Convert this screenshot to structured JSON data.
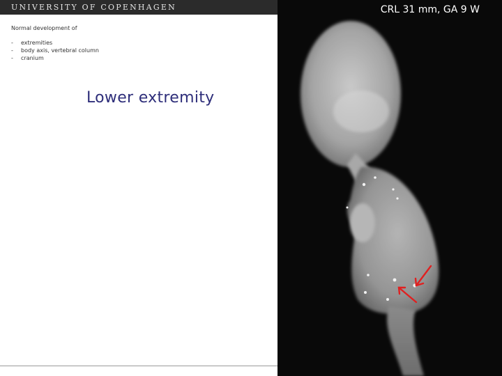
{
  "header": {
    "university": "UNIVERSITY OF COPENHAGEN"
  },
  "content": {
    "subtitle": "Normal development of",
    "topics": [
      {
        "bullet": "-",
        "label": "extremities"
      },
      {
        "bullet": "-",
        "label": "body axis, vertebral column"
      },
      {
        "bullet": "-",
        "label": "cranium"
      }
    ],
    "section_title": "Lower extremity"
  },
  "image": {
    "caption": "CRL 31 mm, GA 9 W",
    "arrow_color": "#e02020",
    "background_color": "#090909"
  }
}
